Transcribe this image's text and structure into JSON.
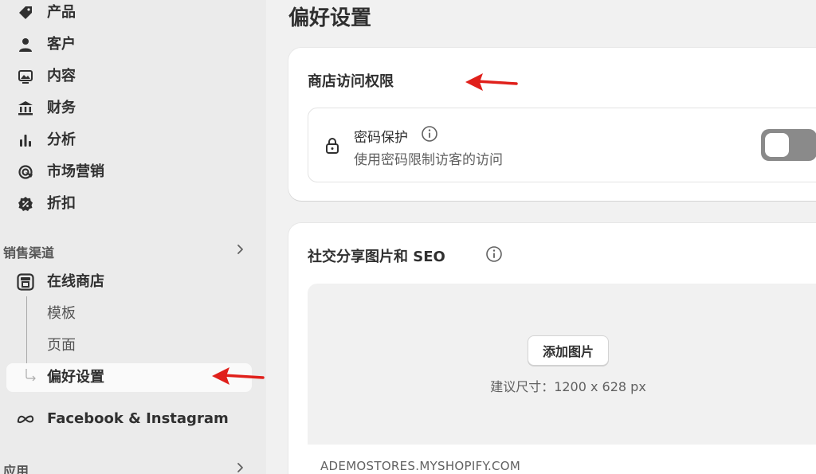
{
  "sidebar": {
    "items": [
      {
        "label": "产品",
        "icon": "tag-icon"
      },
      {
        "label": "客户",
        "icon": "person-icon"
      },
      {
        "label": "内容",
        "icon": "image-icon"
      },
      {
        "label": "财务",
        "icon": "bank-icon"
      },
      {
        "label": "分析",
        "icon": "bar-chart-icon"
      },
      {
        "label": "市场营销",
        "icon": "target-icon"
      },
      {
        "label": "折扣",
        "icon": "discount-icon"
      }
    ],
    "sales_channels": {
      "header": "销售渠道",
      "online_store": "在线商店",
      "sub_items": [
        "模板",
        "页面",
        "偏好设置"
      ],
      "facebook": "Facebook & Instagram"
    },
    "apps_header": "应用"
  },
  "main": {
    "title": "偏好设置",
    "store_access": {
      "title": "商店访问权限",
      "password_label": "密码保护",
      "password_desc": "使用密码限制访客的访问",
      "toggle_on": false
    },
    "social": {
      "title": "社交分享图片和 SEO",
      "add_image": "添加图片",
      "size_hint": "建议尺寸：1200 x 628 px",
      "domain": "ADEMOSTORES.MYSHOPIFY.COM"
    }
  },
  "colors": {
    "annotation_arrow": "#e0201b",
    "toggle_off": "#8a8a8a"
  }
}
